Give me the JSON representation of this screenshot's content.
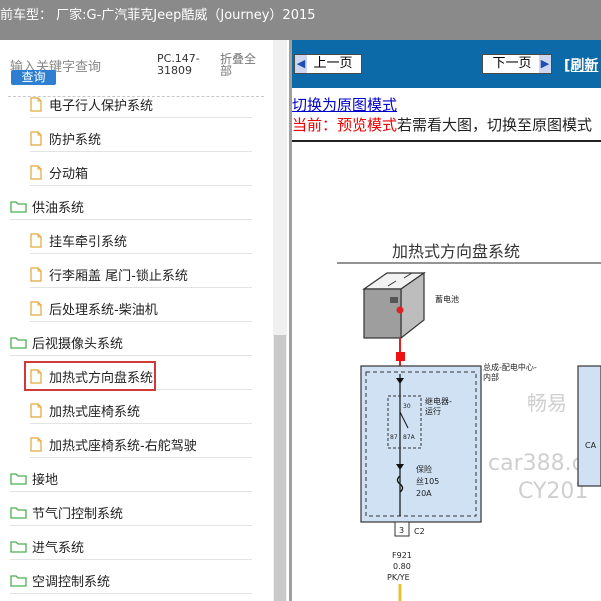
{
  "header": {
    "title": "前车型： 厂家:G-广汽菲克Jeep酷威（Journey）2015"
  },
  "sidebar": {
    "search_hint": "输入关键字查询",
    "query_button": "查询",
    "pc_code": "PC.147-31809",
    "collapse_all": "折叠全部",
    "items": [
      {
        "label": "电子行人保护系统",
        "type": "file",
        "selected": false
      },
      {
        "label": "防护系统",
        "type": "file",
        "selected": false
      },
      {
        "label": "分动箱",
        "type": "file",
        "selected": false
      },
      {
        "label": "供油系统",
        "type": "folder",
        "selected": false
      },
      {
        "label": "挂车牵引系统",
        "type": "file",
        "selected": false
      },
      {
        "label": "行李厢盖 尾门-锁止系统",
        "type": "file",
        "selected": false
      },
      {
        "label": "后处理系统-柴油机",
        "type": "file",
        "selected": false
      },
      {
        "label": "后视摄像头系统",
        "type": "folder",
        "selected": false
      },
      {
        "label": "加热式方向盘系统",
        "type": "file",
        "selected": true
      },
      {
        "label": "加热式座椅系统",
        "type": "file",
        "selected": false
      },
      {
        "label": "加热式座椅系统-右舵驾驶",
        "type": "file",
        "selected": false
      },
      {
        "label": "接地",
        "type": "folder",
        "selected": false
      },
      {
        "label": "节气门控制系统",
        "type": "folder",
        "selected": false
      },
      {
        "label": "进气系统",
        "type": "folder",
        "selected": false
      },
      {
        "label": "空调控制系统",
        "type": "folder",
        "selected": false
      }
    ]
  },
  "toolbar": {
    "prev_page": "上一页",
    "next_page": "下一页",
    "refresh": "[刷新"
  },
  "viewer": {
    "switch_link": "切换为原图模式",
    "current_prefix": "当前：",
    "current_mode": "预览模式",
    "current_note": "若需看大图，切换至原图模式"
  },
  "diagram": {
    "title": "加热式方向盘系统",
    "battery": "蓄电池",
    "junction": "总成-配电中心-",
    "junction2": "内部",
    "relay": "继电器-",
    "relay2": "运行",
    "pin30": "30",
    "pin87": "87",
    "pin87a": "87A",
    "fuse": "保险",
    "fuse2": "丝105",
    "fuse_amp": "20A",
    "conn_pin": "3",
    "conn_name": "C2",
    "wire_code": "F921",
    "wire_size": "0.80",
    "wire_color": "PK/YE",
    "side_text": "CA",
    "wm1": "畅易",
    "wm2": "car388.c",
    "wm3": "CY201"
  },
  "colors": {
    "nav_blue": "#0d6aa8",
    "query_blue": "#2e7fd1",
    "selection_red": "#d23a3a",
    "fuse_box_fill": "#cfe1f3",
    "wire_yellow": "#e8c12e"
  }
}
